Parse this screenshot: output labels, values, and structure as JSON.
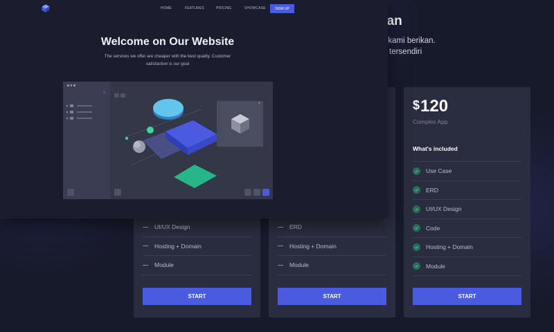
{
  "background": {
    "heading": "kan",
    "subtitle_lines": [
      "ang kami berikan.",
      "tersendiri"
    ],
    "cards": [
      {
        "features": [
          "UI/UX Design",
          "Hosting + Domain",
          "Module"
        ],
        "button": "START"
      },
      {
        "features": [
          "ERD",
          "Hosting + Domain",
          "Module"
        ],
        "button": "START"
      },
      {
        "currency": "$",
        "price": "120",
        "plan": "Complex App",
        "included_label": "What's included",
        "features": [
          "Use Case",
          "ERD",
          "UI/UX Design",
          "Code",
          "Hosting + Domain",
          "Module"
        ],
        "button": "START"
      }
    ]
  },
  "hero": {
    "nav": [
      "HOME",
      "FEATURES",
      "PRICING",
      "SHOWCASE"
    ],
    "signup": "SIGN UP",
    "title": "Welcome on Our Website",
    "description": "The services we offer are cheaper with the best quality. Customer satisfaction is our goal"
  },
  "colors": {
    "accent": "#4a5be0",
    "check_bg": "#2c6b5c",
    "check_mark": "#45c29a",
    "card_bg": "#2a2d40",
    "page_bg": "#171a2b"
  },
  "icons": [
    "logo-cube-icon",
    "check-icon",
    "plus-icon",
    "close-icon",
    "folder-icon"
  ]
}
